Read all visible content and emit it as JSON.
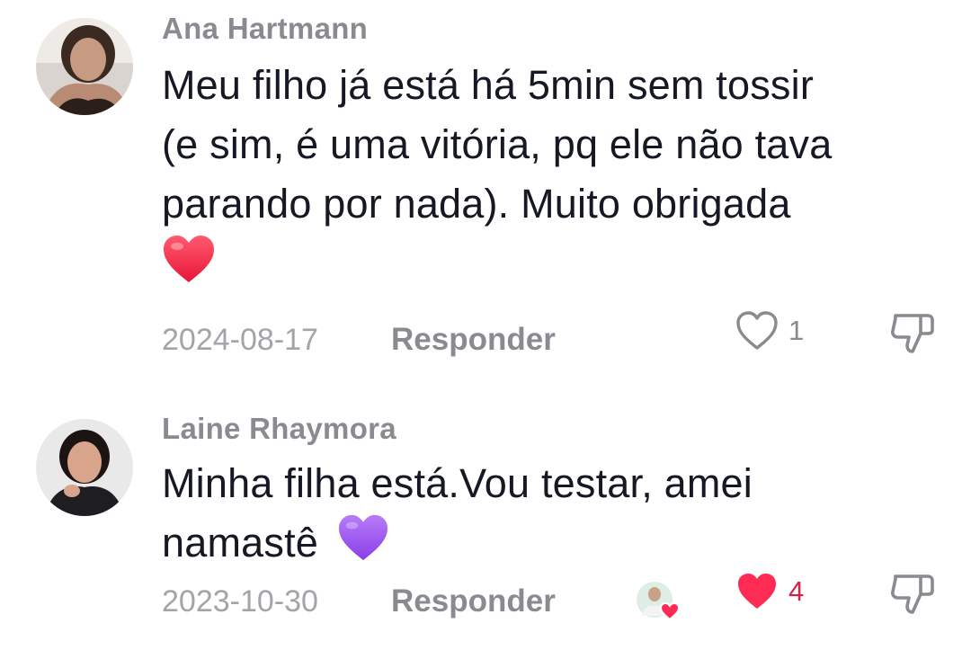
{
  "comments": [
    {
      "author": "Ana Hartmann",
      "text_lines": [
        "Meu filho já está há 5min sem tossir",
        "(e sim, é uma vitória, pq ele não tava",
        "parando por nada). Muito obrigada"
      ],
      "emoji": "red-heart",
      "date": "2024-08-17",
      "reply_label": "Responder",
      "likes": "1",
      "liked": false,
      "avatar_colors": {
        "bg": "#d9d4cf",
        "skin": "#c79a82",
        "hair": "#3b2a22"
      }
    },
    {
      "author": "Laine Rhaymora",
      "text_lines": [
        "Minha filha está.Vou testar, amei",
        "namastê"
      ],
      "emoji": "purple-heart",
      "date": "2023-10-30",
      "reply_label": "Responder",
      "likes": "4",
      "liked": true,
      "creator_liked": true,
      "avatar_colors": {
        "bg": "#e9e9ea",
        "skin": "#d8a58c",
        "hair": "#1c1412"
      }
    }
  ],
  "colors": {
    "like_active": "#fe2c55",
    "like_count_active": "#d0234a",
    "muted": "#8a8b91",
    "text": "#161823"
  }
}
